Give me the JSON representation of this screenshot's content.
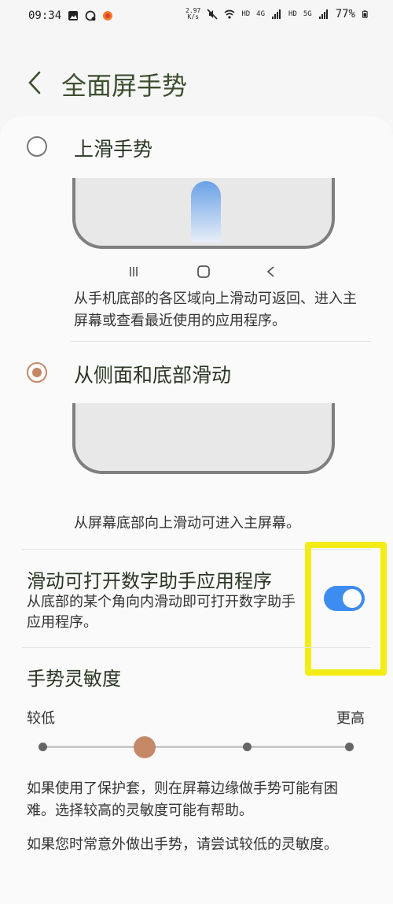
{
  "status_bar": {
    "time": "09:34",
    "speed_value": "2.97",
    "speed_unit": "K/s",
    "hd1": "HD",
    "net1": "4G",
    "hd2": "HD",
    "net2": "5G",
    "battery": "77%"
  },
  "header": {
    "title": "全面屏手势"
  },
  "options": [
    {
      "title": "上滑手势",
      "description": "从手机底部的各区域向上滑动可返回、进入主屏幕或查看最近使用的应用程序。",
      "selected": false
    },
    {
      "title": "从侧面和底部滑动",
      "description": "从屏幕底部向上滑动可进入主屏幕。",
      "selected": true
    }
  ],
  "assistant_toggle": {
    "title": "滑动可打开数字助手应用程序",
    "description": "从底部的某个角向内滑动即可打开数字助手应用程序。",
    "enabled": true
  },
  "sensitivity": {
    "title": "手势灵敏度",
    "low_label": "较低",
    "high_label": "更高",
    "level": 1,
    "levels": 4
  },
  "notes": [
    "如果使用了保护套，则在屏幕边缘做手势可能有困难。选择较高的灵敏度可能有帮助。",
    "如果您时常意外做出手势，请尝试较低的灵敏度。"
  ],
  "colors": {
    "accent": "#c58867",
    "switch_on": "#3d8cf0",
    "highlight": "#f3ec17"
  }
}
